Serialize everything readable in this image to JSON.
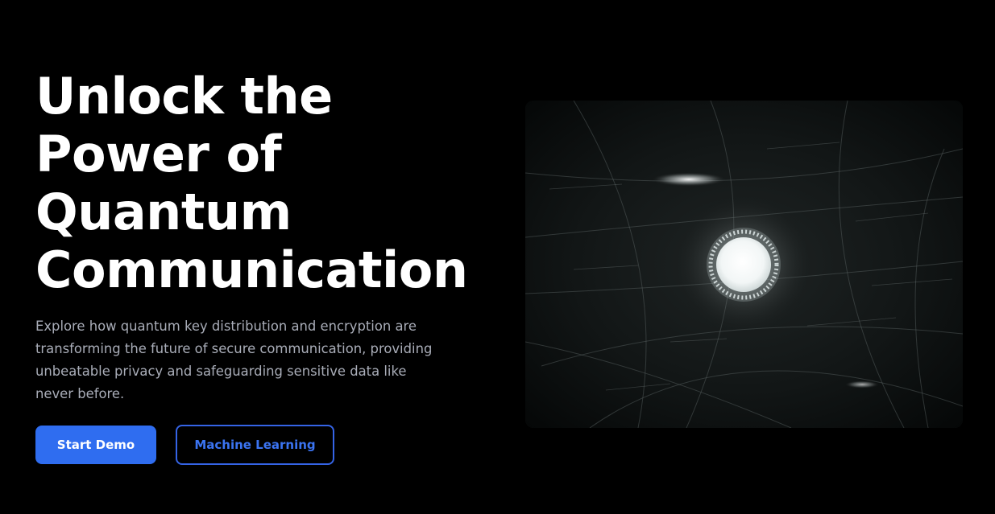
{
  "hero": {
    "title_lines": [
      "Unlock the",
      "Power of",
      "Quantum",
      "Communication"
    ],
    "description": "Explore how quantum key distribution and encryption are transforming the future of secure communication, providing unbeatable privacy and safeguarding sensitive data like never before."
  },
  "buttons": {
    "primary_label": "Start Demo",
    "secondary_label": "Machine Learning"
  },
  "media": {
    "icon": "glowing-quantum-particle-image"
  },
  "colors": {
    "background": "#000000",
    "primary": "#2f6df0",
    "secondary_border": "#3564e6",
    "description_text": "#a9adb8"
  }
}
